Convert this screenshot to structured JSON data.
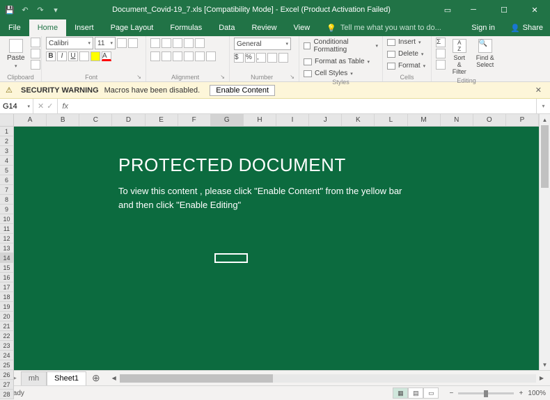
{
  "title": "Document_Covid-19_7.xls  [Compatibility Mode] - Excel (Product Activation Failed)",
  "tabs": {
    "file": "File",
    "home": "Home",
    "insert": "Insert",
    "page_layout": "Page Layout",
    "formulas": "Formulas",
    "data": "Data",
    "review": "Review",
    "view": "View",
    "tellme": "Tell me what you want to do...",
    "signin": "Sign in",
    "share": "Share"
  },
  "ribbon": {
    "clipboard": {
      "title": "Clipboard",
      "paste": "Paste"
    },
    "font": {
      "title": "Font",
      "family": "Calibri",
      "size": "11"
    },
    "alignment": {
      "title": "Alignment"
    },
    "number": {
      "title": "Number",
      "format": "General"
    },
    "styles": {
      "title": "Styles",
      "cond": "Conditional Formatting",
      "table": "Format as Table",
      "cell": "Cell Styles"
    },
    "cells": {
      "title": "Cells",
      "insert": "Insert",
      "delete": "Delete",
      "format": "Format"
    },
    "editing": {
      "title": "Editing",
      "sort": "Sort & Filter",
      "find": "Find & Select"
    }
  },
  "security": {
    "title": "SECURITY WARNING",
    "msg": "Macros have been disabled.",
    "button": "Enable Content"
  },
  "namebox": "G14",
  "fx_label": "fx",
  "columns": [
    "A",
    "B",
    "C",
    "D",
    "E",
    "F",
    "G",
    "H",
    "I",
    "J",
    "K",
    "L",
    "M",
    "N",
    "O",
    "P"
  ],
  "rows_visible": 28,
  "doc": {
    "heading": "PROTECTED DOCUMENT",
    "line1": "To view this content , please click  \"Enable Content\"  from the yellow bar",
    "line2": "and then click  \"Enable Editing\""
  },
  "sheets": {
    "inactive": "mh",
    "active": "Sheet1"
  },
  "status": {
    "ready": "Ready",
    "zoom": "100%"
  }
}
